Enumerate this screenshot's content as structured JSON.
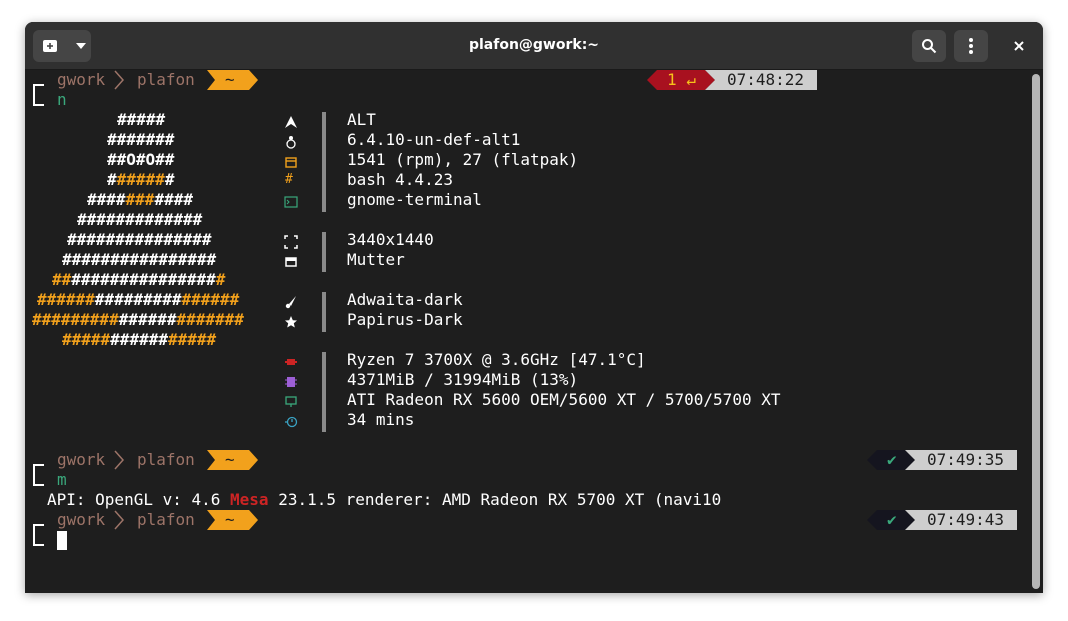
{
  "window": {
    "title": "plafon@gwork:~"
  },
  "prompts": [
    {
      "host": "gwork",
      "dir": "plafon",
      "home": "~",
      "time": "07:48:22",
      "status": "1 ↵",
      "command": "n"
    },
    {
      "host": "gwork",
      "dir": "plafon",
      "home": "~",
      "time": "07:49:35",
      "status": "✔",
      "command": "m"
    },
    {
      "host": "gwork",
      "dir": "plafon",
      "home": "~",
      "time": "07:49:43",
      "status": "✔",
      "command": ""
    }
  ],
  "logo_lines": [
    [
      {
        "t": "#####",
        "c": "w"
      }
    ],
    [
      {
        "t": "#######",
        "c": "w"
      }
    ],
    [
      {
        "t": "##O#O##",
        "c": "w"
      }
    ],
    [
      {
        "t": "#",
        "c": "w"
      },
      {
        "t": "#####",
        "c": "o"
      },
      {
        "t": "#",
        "c": "w"
      }
    ],
    [
      {
        "t": "####",
        "c": "w"
      },
      {
        "t": "###",
        "c": "o"
      },
      {
        "t": "####",
        "c": "w"
      }
    ],
    [
      {
        "t": "#############",
        "c": "w"
      }
    ],
    [
      {
        "t": "###############",
        "c": "w"
      }
    ],
    [
      {
        "t": "################",
        "c": "w"
      }
    ],
    [
      {
        "t": "##",
        "c": "o"
      },
      {
        "t": "###############",
        "c": "w"
      },
      {
        "t": "#",
        "c": "o"
      }
    ],
    [
      {
        "t": "######",
        "c": "o"
      },
      {
        "t": "#########",
        "c": "w"
      },
      {
        "t": "######",
        "c": "o"
      }
    ],
    [
      {
        "t": "#########",
        "c": "o"
      },
      {
        "t": "######",
        "c": "w"
      },
      {
        "t": "#######",
        "c": "o"
      }
    ],
    [
      {
        "t": "#####",
        "c": "o"
      },
      {
        "t": "######",
        "c": "w"
      },
      {
        "t": "#####",
        "c": "o"
      }
    ]
  ],
  "sysinfo": {
    "os": "ALT",
    "kernel": "6.4.10-un-def-alt1",
    "packages": "1541 (rpm), 27 (flatpak)",
    "shell": "bash 4.4.23",
    "terminal": "gnome-terminal",
    "resolution": "3440x1440",
    "wm": "Mutter",
    "theme": "Adwaita-dark",
    "icons": "Papirus-Dark",
    "cpu": "Ryzen 7 3700X @ 3.6GHz [47.1°C]",
    "memory": "4371MiB / 31994MiB (13%)",
    "gpu": "ATI Radeon RX 5600 OEM/5600 XT / 5700/5700 XT",
    "uptime": "34 mins"
  },
  "glinfo": {
    "prefix": "API: OpenGL v: 4.6 ",
    "mesa": "Mesa",
    "suffix": " 23.1.5 renderer: AMD Radeon RX 5700 XT (navi10"
  },
  "colors": {
    "accent_orange": "#f2a11c",
    "error_red": "#cc2424",
    "prompt_green": "#3aa87c",
    "prompt_text": "#9d7468"
  }
}
